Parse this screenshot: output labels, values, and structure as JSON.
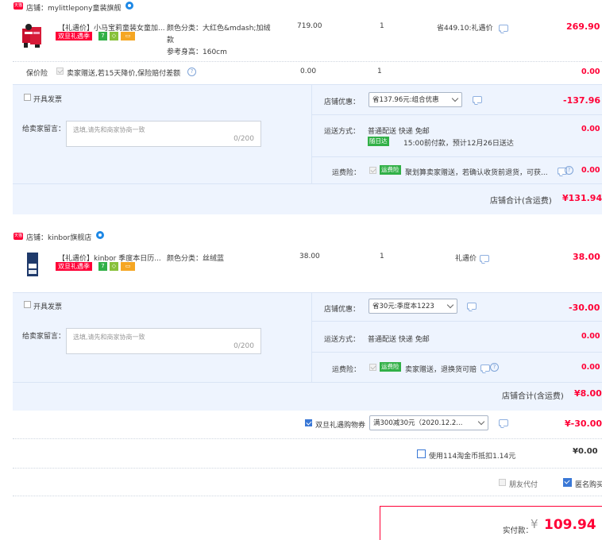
{
  "store1": {
    "label": "店铺：mylittlepony童装旗舰",
    "item": {
      "title": "【礼遇价】小马宝莉童装女童加...",
      "tag_festival": "双旦礼遇季",
      "tag_7": "7",
      "spec_line1": "颜色分类：大红色&mdash;加绒",
      "spec_line2": "款",
      "spec_line3": "参考身高：160cm",
      "unit_price": "719.00",
      "qty": "1",
      "promo": "省449.10:礼遇价",
      "subtotal": "269.90"
    },
    "insurance": {
      "label": "保价险",
      "desc": "卖家赠送,若15天降价,保险赔付差额",
      "price": "0.00",
      "qty": "1",
      "subtotal": "0.00"
    },
    "invoice_label": "开具发票",
    "message": {
      "label": "给卖家留言：",
      "placeholder": "选填,请先和商家协商一致",
      "count": "0/200"
    },
    "coupon": {
      "label": "店铺优惠：",
      "selected": "省137.96元:组合优惠",
      "amount": "-137.96"
    },
    "shipping": {
      "label": "运送方式：",
      "method": "普通配送 快递 免邮",
      "badge": "随日达",
      "eta": "15:00前付款，预计12月26日送达",
      "amount": "0.00"
    },
    "freight_ins": {
      "label": "运费险：",
      "badge": "运费险",
      "desc": "聚划算卖家赠送，若确认收货前退货，可获...",
      "amount": "0.00"
    },
    "total_label": "店铺合计(含运费)",
    "total": "¥131.94"
  },
  "store2": {
    "label": "店铺：kinbor旗舰店",
    "item": {
      "title": "【礼遇价】kinbor 季度本日历...",
      "tag_festival": "双旦礼遇季",
      "tag_7": "7",
      "spec_line1": "颜色分类：丝绒蓝",
      "unit_price": "38.00",
      "qty": "1",
      "promo": "礼遇价",
      "subtotal": "38.00"
    },
    "invoice_label": "开具发票",
    "message": {
      "label": "给卖家留言：",
      "placeholder": "选填,请先和商家协商一致",
      "count": "0/200"
    },
    "coupon": {
      "label": "店铺优惠：",
      "selected": "省30元:季度本1223",
      "amount": "-30.00"
    },
    "shipping": {
      "label": "运送方式：",
      "method": "普通配送 快递 免邮",
      "amount": "0.00"
    },
    "freight_ins": {
      "label": "运费险：",
      "badge": "运费险",
      "desc": "卖家赠送，退换货可赔",
      "amount": "0.00"
    },
    "total_label": "店铺合计(含运费)",
    "total": "¥8.00"
  },
  "cross_store": {
    "label": "双旦礼遇购物券",
    "selected": "满300减30元（2020.12.2...",
    "amount": "¥-30.00"
  },
  "coins": {
    "label": "使用114淘金币抵扣1.14元",
    "amount": "¥0.00"
  },
  "options": {
    "friend_pay": "朋友代付",
    "anonymous": "匿名购买"
  },
  "payment": {
    "label": "实付款：",
    "currency": "¥",
    "amount": "109.94"
  },
  "colors": {
    "accent_red": "#ff0036",
    "blue": "#3a78d6",
    "band": "#eef4fe"
  }
}
